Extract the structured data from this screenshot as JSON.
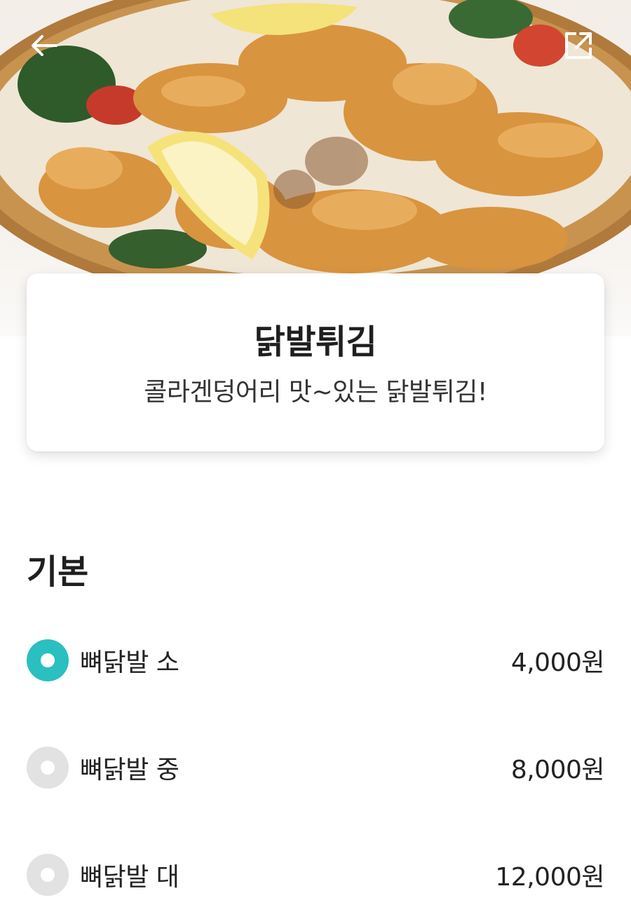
{
  "header": {
    "back_icon": "arrow-left-icon",
    "share_icon": "share-external-icon"
  },
  "menu": {
    "title": "닭발튀김",
    "description": "콜라겐덩어리 맛~있는 닭발튀김!"
  },
  "options_section": {
    "title": "기본",
    "accent_color": "#2bbfbf",
    "items": [
      {
        "label": "뼈닭발 소",
        "price": "4,000원",
        "selected": true
      },
      {
        "label": "뼈닭발 중",
        "price": "8,000원",
        "selected": false
      },
      {
        "label": "뼈닭발 대",
        "price": "12,000원",
        "selected": false
      }
    ]
  }
}
